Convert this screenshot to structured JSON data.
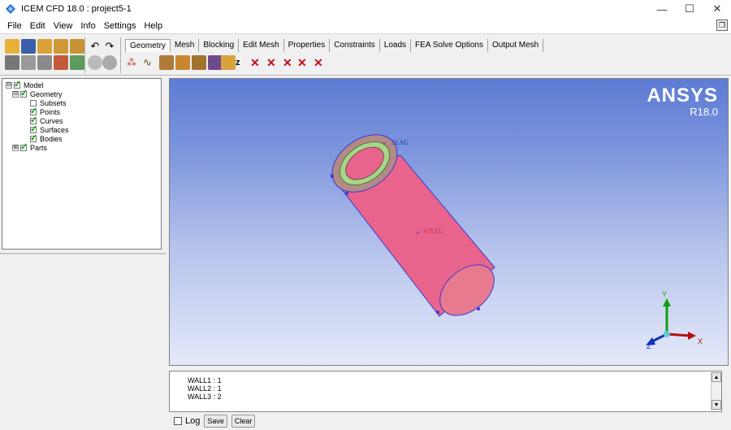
{
  "window": {
    "title": "ICEM CFD 18.0 : project5-1",
    "controls": {
      "minimize": "—",
      "maximize": "☐",
      "close": "✕"
    }
  },
  "menu": {
    "items": [
      "File",
      "Edit",
      "View",
      "Info",
      "Settings",
      "Help"
    ]
  },
  "tabs": {
    "active": "Geometry",
    "labels": [
      "Geometry",
      "Mesh",
      "Blocking",
      "Edit Mesh",
      "Properties",
      "Constraints",
      "Loads",
      "FEA Solve Options",
      "Output Mesh"
    ]
  },
  "tree": {
    "nodes": [
      {
        "label": "Model",
        "expander": "⊟",
        "checked": true
      },
      {
        "label": "Geometry",
        "expander": "⊟",
        "checked": true
      },
      {
        "label": "Subsets",
        "checked": false
      },
      {
        "label": "Points",
        "checked": true
      },
      {
        "label": "Curves",
        "checked": true
      },
      {
        "label": "Surfaces",
        "checked": true
      },
      {
        "label": "Bodies",
        "checked": true
      },
      {
        "label": "Parts",
        "expander": "⊞",
        "checked": true
      }
    ]
  },
  "viewport": {
    "brand": "ANSYS",
    "version": "R18.0",
    "labels": {
      "slag": "SLAG",
      "steel": "STEEL"
    },
    "axes": {
      "x": "X",
      "y": "Y",
      "z": "Z"
    },
    "colors": {
      "cylinder": "#e8648c",
      "inner_ring": "#a9d48a",
      "outline": "#3a3ad0",
      "axis_x": "#b01010",
      "axis_y": "#10a010",
      "axis_z": "#1030c0"
    }
  },
  "console": {
    "lines": [
      "WALL1 : 1",
      "WALL2 : 1",
      "WALL3 : 2"
    ]
  },
  "bottom": {
    "log_label": "Log",
    "save_label": "Save",
    "clear_label": "Clear"
  }
}
